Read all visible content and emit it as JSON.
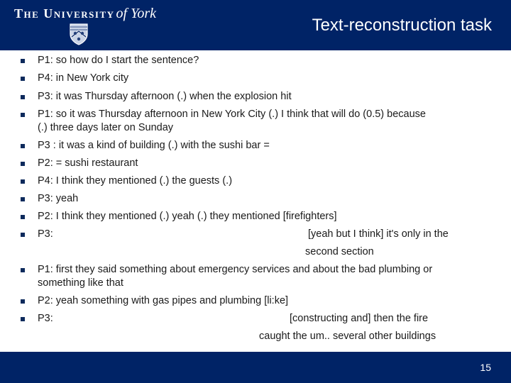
{
  "header": {
    "logo_caps": "The University",
    "logo_script": "of York",
    "title": "Text-reconstruction task"
  },
  "transcript": [
    {
      "speaker": "P1:",
      "text": "P1:  so how do I start the sentence?"
    },
    {
      "speaker": "P4:",
      "text": "P4:  in New York city"
    },
    {
      "speaker": "P3:",
      "text": "P3:  it was Thursday afternoon (.) when the explosion hit"
    },
    {
      "speaker": "P1:",
      "text": "P1: so it was Thursday afternoon in New York City (.) I think that will do (0.5) because",
      "continuation": "(.) three days later on Sunday"
    },
    {
      "speaker": "P3",
      "text": "P3 : it was a kind of building (.)  with the sushi bar ="
    },
    {
      "speaker": "P2:",
      "text": "P2:  = sushi restaurant"
    },
    {
      "speaker": "P4:",
      "text": "P4: I think they mentioned (.) the guests (.)"
    },
    {
      "speaker": "P3:",
      "text": "P3: yeah"
    },
    {
      "speaker": "P2:",
      "text": "P2: I think they mentioned (.) yeah (.) they mentioned [firefighters]"
    },
    {
      "speaker": "P3:",
      "text": "P3:",
      "overlap": "[yeah but I think] it's only in the",
      "continuation": "second section"
    },
    {
      "speaker": "P1:",
      "text": "P1: first they said something about emergency services and about the bad plumbing or",
      "continuation": "something like that"
    },
    {
      "speaker": "P2:",
      "text": "P2: yeah something with gas pipes and plumbing  [li:ke]"
    },
    {
      "speaker": "P3:",
      "text": "P3:",
      "overlap": "[constructing and] then the fire",
      "continuation": "caught the um.. several other buildings"
    }
  ],
  "footer": {
    "page_number": "15"
  },
  "colors": {
    "brand_navy": "#002366",
    "bullet": "#0d2a5c",
    "text": "#1a1a1a"
  }
}
